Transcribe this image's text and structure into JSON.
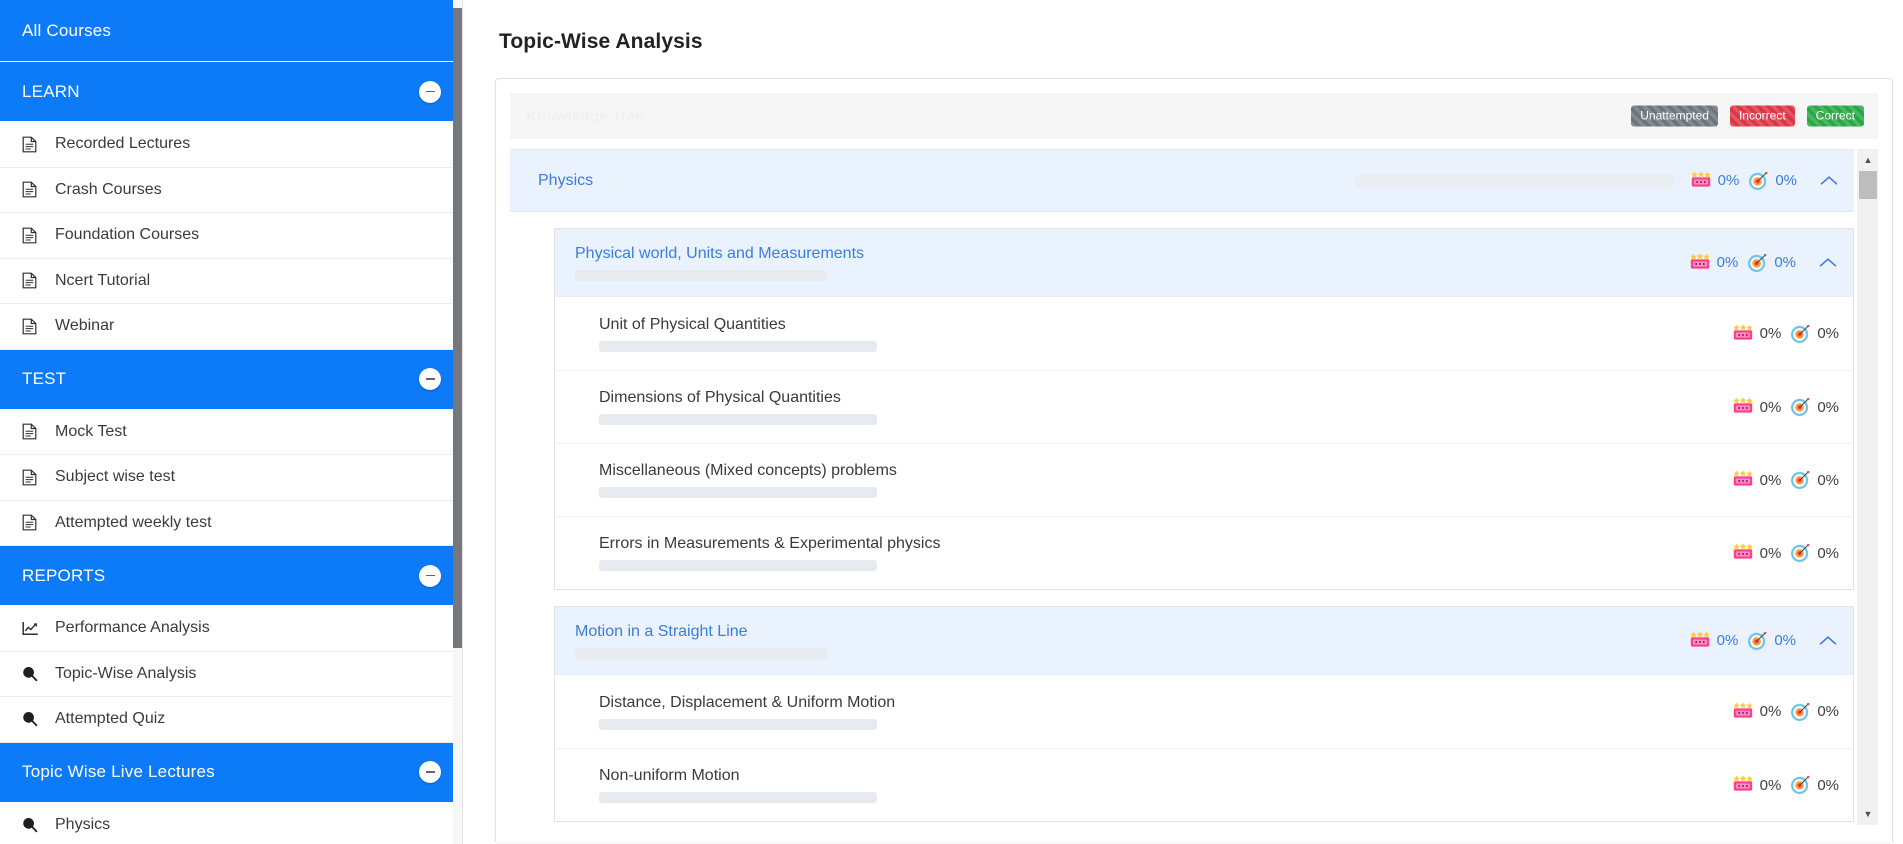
{
  "sidebar": {
    "scroll_visible": true,
    "groups": [
      {
        "type": "section",
        "label": "All Courses",
        "collapsible": false
      },
      {
        "type": "section",
        "label": "LEARN",
        "collapsible": true,
        "items": [
          {
            "label": "Recorded Lectures",
            "icon": "file-icon"
          },
          {
            "label": "Crash Courses",
            "icon": "file-icon"
          },
          {
            "label": "Foundation Courses",
            "icon": "file-icon"
          },
          {
            "label": "Ncert Tutorial",
            "icon": "file-icon"
          },
          {
            "label": "Webinar",
            "icon": "file-icon"
          }
        ]
      },
      {
        "type": "section",
        "label": "TEST",
        "collapsible": true,
        "items": [
          {
            "label": "Mock Test",
            "icon": "file-icon"
          },
          {
            "label": "Subject wise test",
            "icon": "file-icon"
          },
          {
            "label": "Attempted weekly test",
            "icon": "file-icon"
          }
        ]
      },
      {
        "type": "section",
        "label": "REPORTS",
        "collapsible": true,
        "items": [
          {
            "label": "Performance Analysis",
            "icon": "chart-line-icon"
          },
          {
            "label": "Topic-Wise Analysis",
            "icon": "search-icon"
          },
          {
            "label": "Attempted Quiz",
            "icon": "search-icon"
          }
        ]
      },
      {
        "type": "section",
        "label": "Topic Wise Live Lectures",
        "collapsible": true,
        "items": [
          {
            "label": "Physics",
            "icon": "search-icon"
          }
        ]
      }
    ]
  },
  "main": {
    "page_title": "Topic-Wise Analysis",
    "panel": {
      "heading": "Knowledge Tree",
      "legend": [
        {
          "label": "Unattempted",
          "color": "#6c757d",
          "key": "unattempted"
        },
        {
          "label": "Incorrect",
          "color": "#dc3545",
          "key": "incorrect"
        },
        {
          "label": "Correct",
          "color": "#28a745",
          "key": "correct"
        }
      ]
    },
    "metric_icons": {
      "rank": "rank-ticket-icon",
      "accuracy": "target-icon"
    },
    "tree": {
      "subject": {
        "label": "Physics",
        "rank_pct": "0%",
        "accuracy_pct": "0%",
        "expanded": true
      },
      "chapters": [
        {
          "label": "Physical world, Units and Measurements",
          "rank_pct": "0%",
          "accuracy_pct": "0%",
          "expanded": true,
          "topics": [
            {
              "label": "Unit of Physical Quantities",
              "rank_pct": "0%",
              "accuracy_pct": "0%"
            },
            {
              "label": "Dimensions of Physical Quantities",
              "rank_pct": "0%",
              "accuracy_pct": "0%"
            },
            {
              "label": "Miscellaneous (Mixed concepts) problems",
              "rank_pct": "0%",
              "accuracy_pct": "0%"
            },
            {
              "label": "Errors in Measurements & Experimental physics",
              "rank_pct": "0%",
              "accuracy_pct": "0%"
            }
          ]
        },
        {
          "label": "Motion in a Straight Line",
          "rank_pct": "0%",
          "accuracy_pct": "0%",
          "expanded": true,
          "topics": [
            {
              "label": "Distance, Displacement & Uniform Motion",
              "rank_pct": "0%",
              "accuracy_pct": "0%"
            },
            {
              "label": "Non-uniform Motion",
              "rank_pct": "0%",
              "accuracy_pct": "0%"
            }
          ]
        }
      ]
    }
  },
  "colors": {
    "brand_blue": "#0d7bf7",
    "link_blue": "#3b7ddd",
    "row_highlight": "#eaf2fe",
    "unattempted": "#6c757d",
    "incorrect": "#dc3545",
    "correct": "#28a745"
  }
}
